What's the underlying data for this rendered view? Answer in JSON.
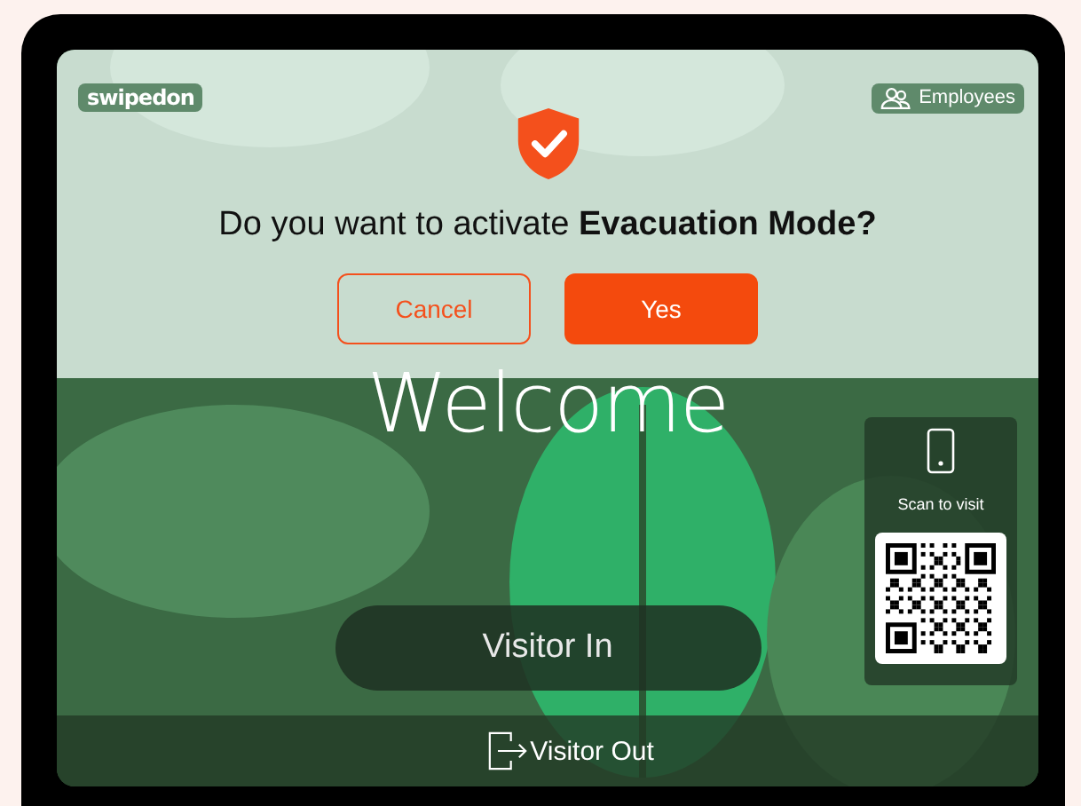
{
  "brand": {
    "logo": "swipedon"
  },
  "header": {
    "employees_link": "Employees"
  },
  "dialog": {
    "question": "Do you want to activate **Evacuation Mode?**",
    "buttons": [
      {
        "label": "Cancel",
        "kind": "secondary"
      },
      {
        "label": "Yes",
        "kind": "primary"
      }
    ]
  },
  "welcome": "Welcome",
  "visitor_in": "Visitor In",
  "scan_panel": {
    "label": "Scan to visit"
  },
  "visitor_out": "Visitor Out"
}
